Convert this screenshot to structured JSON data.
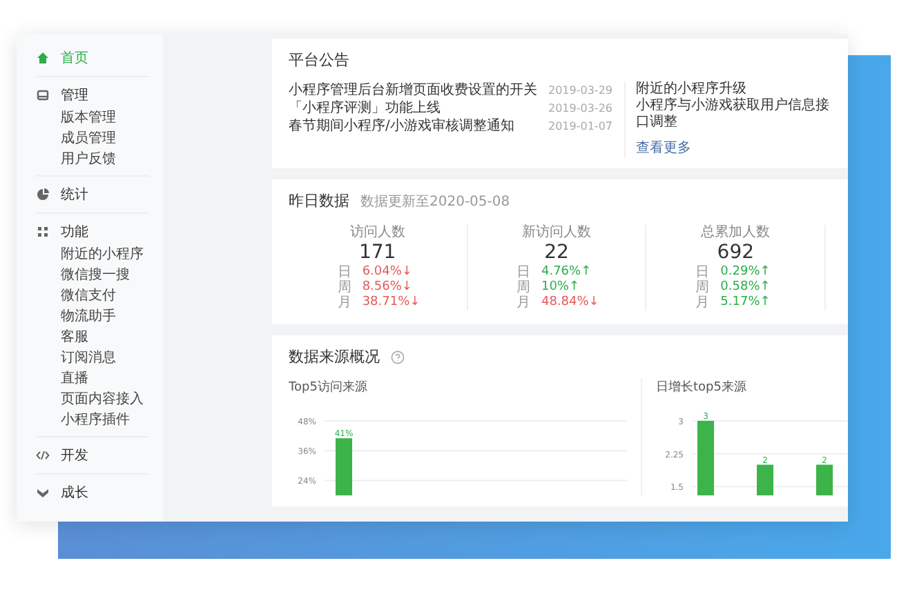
{
  "sidebar": {
    "items": [
      {
        "label": "首页",
        "selected": true
      },
      {
        "label": "管理",
        "selected": false,
        "children": [
          {
            "label": "版本管理",
            "selected": false
          },
          {
            "label": "成员管理",
            "selected": false
          },
          {
            "label": "用户反馈",
            "selected": false
          }
        ]
      },
      {
        "label": "统计",
        "selected": false
      },
      {
        "label": "功能",
        "selected": false,
        "children": [
          {
            "label": "附近的小程序",
            "selected": false
          },
          {
            "label": "微信搜一搜",
            "selected": false
          },
          {
            "label": "微信支付",
            "selected": false
          },
          {
            "label": "物流助手",
            "selected": false
          },
          {
            "label": "客服",
            "selected": false
          },
          {
            "label": "订阅消息",
            "selected": false
          },
          {
            "label": "直播",
            "selected": false
          },
          {
            "label": "页面内容接入",
            "selected": false
          },
          {
            "label": "小程序插件",
            "selected": false
          }
        ]
      },
      {
        "label": "开发",
        "selected": false
      },
      {
        "label": "成长",
        "selected": false
      }
    ]
  },
  "announcements": {
    "title": "平台公告",
    "items": [
      {
        "title": "小程序管理后台新增页面收费设置的开关",
        "date": "2019-03-29"
      },
      {
        "title": "「小程序评测」功能上线",
        "date": "2019-03-26"
      },
      {
        "title": "春节期间小程序/小游戏审核调整通知",
        "date": "2019-01-07"
      }
    ],
    "side_items": [
      {
        "title": "附近的小程序升级"
      },
      {
        "title": "小程序与小游戏获取用户信息接口调整"
      }
    ],
    "more_link": "查看更多"
  },
  "yesterday": {
    "title": "昨日数据",
    "subtitle": "数据更新至2020-05-08",
    "stats": [
      {
        "label": "访问人数",
        "value": "171",
        "changes": [
          {
            "period": "日",
            "value": "6.04%↓",
            "color": "#e25b5b"
          },
          {
            "period": "周",
            "value": "8.56%↓",
            "color": "#e25b5b"
          },
          {
            "period": "月",
            "value": "38.71%↓",
            "color": "#e25b5b"
          }
        ]
      },
      {
        "label": "新访问人数",
        "value": "22",
        "changes": [
          {
            "period": "日",
            "value": "4.76%↑",
            "color": "#2aae4a"
          },
          {
            "period": "周",
            "value": "10%↑",
            "color": "#2aae4a"
          },
          {
            "period": "月",
            "value": "48.84%↓",
            "color": "#e25b5b"
          }
        ]
      },
      {
        "label": "总累加人数",
        "value": "692",
        "changes": [
          {
            "period": "日",
            "value": "0.29%↑",
            "color": "#2aae4a"
          },
          {
            "period": "周",
            "value": "0.58%↑",
            "color": "#2aae4a"
          },
          {
            "period": "月",
            "value": "5.17%↑",
            "color": "#2aae4a"
          }
        ]
      }
    ]
  },
  "sources": {
    "title": "数据来源概况",
    "charts": [
      {
        "title": "Top5访问来源",
        "chart_data": {
          "type": "bar",
          "values": [
            41
          ],
          "ylim": [
            18,
            48
          ],
          "grid": true,
          "yticks": [
            {
              "value": 24,
              "label": "24%"
            },
            {
              "value": 36,
              "label": "36%"
            },
            {
              "value": 48,
              "label": "48%"
            }
          ],
          "value_labels": [
            "41%"
          ]
        }
      },
      {
        "title": "日增长top5来源",
        "chart_data": {
          "type": "bar",
          "values": [
            3,
            2,
            2
          ],
          "ylim": [
            1.3,
            3
          ],
          "grid": true,
          "yticks": [
            {
              "value": 1.5,
              "label": "1.5"
            },
            {
              "value": 2.25,
              "label": "2.25"
            },
            {
              "value": 3,
              "label": "3"
            }
          ],
          "value_labels": [
            "3",
            "2",
            "2"
          ]
        }
      }
    ]
  }
}
